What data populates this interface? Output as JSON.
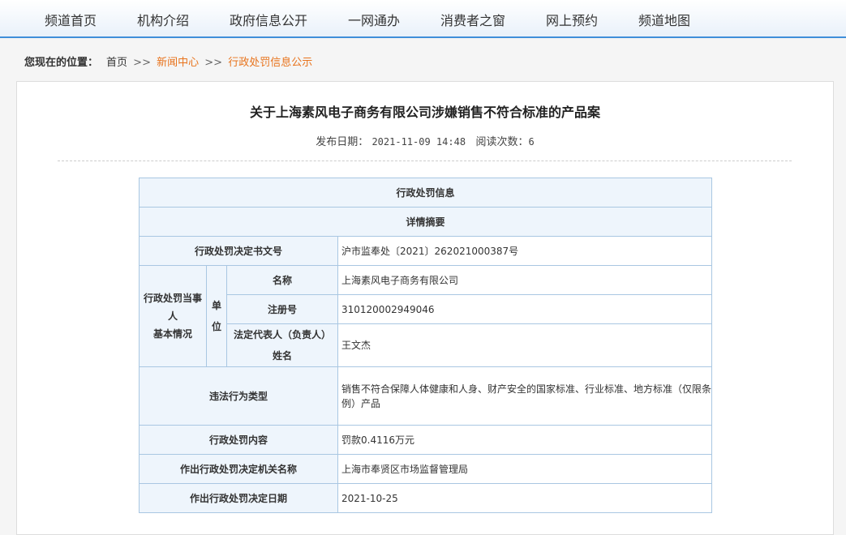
{
  "nav": {
    "items": [
      "频道首页",
      "机构介绍",
      "政府信息公开",
      "一网通办",
      "消费者之窗",
      "网上预约",
      "频道地图"
    ]
  },
  "breadcrumb": {
    "label": "您现在的位置：",
    "home": "首页",
    "sep1": ">>",
    "news": "新闻中心",
    "sep2": ">>",
    "current": "行政处罚信息公示"
  },
  "article": {
    "title": "关于上海素风电子商务有限公司涉嫌销售不符合标准的产品案",
    "date_label": "发布日期：",
    "date": "2021-11-09 14:48",
    "reads_label": "阅读次数：",
    "reads": "6"
  },
  "table": {
    "header": "行政处罚信息",
    "subheader": "详情摘要",
    "doc_no_label": "行政处罚决定书文号",
    "doc_no": "沪市监奉处〔2021〕262021000387号",
    "party_label_1": "行政处罚当事",
    "party_label_2": "人",
    "party_label_3": "基本情况",
    "unit_label_1": "单",
    "unit_label_2": "位",
    "name_label": "名称",
    "name": "上海素风电子商务有限公司",
    "reg_label": "注册号",
    "reg": "310120002949046",
    "rep_label_1": "法定代表人（负责人）",
    "rep_label_2": "姓名",
    "rep": "王文杰",
    "violation_label": "违法行为类型",
    "violation_1": "销售不符合保障人体健康和人身、财产安全的国家标准、行业标准、地方标准（仅限条",
    "violation_2": "例）产品",
    "penalty_label": "行政处罚内容",
    "penalty": "罚款0.4116万元",
    "authority_label": "作出行政处罚决定机关名称",
    "authority": "上海市奉贤区市场监督管理局",
    "decision_date_label": "作出行政处罚决定日期",
    "decision_date": "2021-10-25"
  },
  "colors": {
    "accent": "#3f8fd9",
    "link": "#e8731c",
    "table_border": "#a9c7e2",
    "label_bg": "#eef5fc"
  }
}
